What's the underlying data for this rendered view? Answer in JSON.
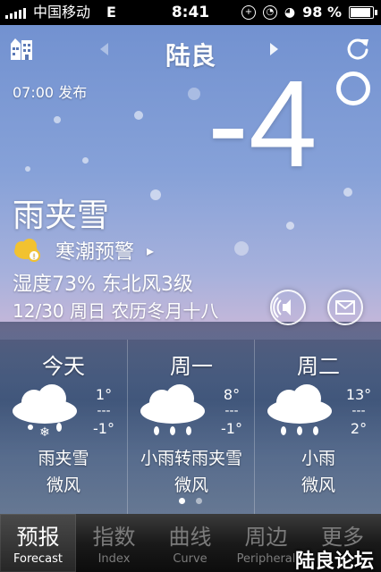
{
  "status": {
    "carrier": "中国移动",
    "network": "E",
    "time": "8:41",
    "battery": "98 %",
    "battery_level": 0.98
  },
  "header": {
    "city": "陆良",
    "left_icon": "city-buildings-icon",
    "right_icon": "refresh-icon"
  },
  "current": {
    "published": "07:00 发布",
    "temperature": "-4",
    "condition": "雨夹雪",
    "alert": "寒潮预警",
    "alert_icon": "cold-wave-warning-icon",
    "humidity_wind": "湿度73%  东北风3级",
    "date_line": "12/30 周日 农历冬月十八",
    "voice_icon": "speaker-icon",
    "share_icon": "mail-icon"
  },
  "forecast": [
    {
      "day": "今天",
      "hi": "1°",
      "mid": "---",
      "lo": "-1°",
      "condition": "雨夹雪",
      "wind": "微风",
      "icon": "sleet-icon"
    },
    {
      "day": "周一",
      "hi": "8°",
      "mid": "---",
      "lo": "-1°",
      "condition": "小雨转雨夹雪",
      "wind": "微风",
      "icon": "rain-icon"
    },
    {
      "day": "周二",
      "hi": "13°",
      "mid": "---",
      "lo": "2°",
      "condition": "小雨",
      "wind": "微风",
      "icon": "rain-icon"
    }
  ],
  "pager": {
    "pages": 2,
    "current": 1
  },
  "tabs": [
    {
      "cn": "预报",
      "en": "Forecast",
      "active": true
    },
    {
      "cn": "指数",
      "en": "Index",
      "active": false
    },
    {
      "cn": "曲线",
      "en": "Curve",
      "active": false
    },
    {
      "cn": "周边",
      "en": "Peripheral",
      "active": false
    },
    {
      "cn": "更多",
      "en": "",
      "active": false
    }
  ],
  "watermark": "陆良论坛"
}
